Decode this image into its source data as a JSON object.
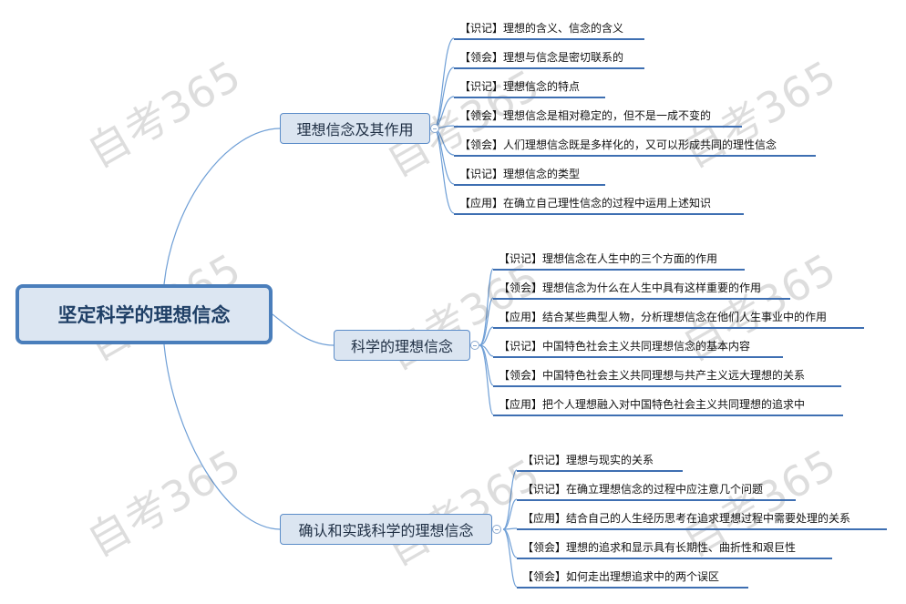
{
  "watermark": "自考365",
  "root": {
    "label": "坚定科学的理想信念"
  },
  "branches": [
    {
      "label": "理想信念及其作用",
      "items": [
        "【识记】理想的含义、信念的含义",
        "【领会】理想与信念是密切联系的",
        "【识记】理想信念的特点",
        "【领会】理想信念是相对稳定的，但不是一成不变的",
        "【领会】人们理想信念既是多样化的，又可以形成共同的理性信念",
        "【识记】理想信念的类型",
        "【应用】在确立自己理性信念的过程中运用上述知识"
      ]
    },
    {
      "label": "科学的理想信念",
      "items": [
        "【识记】理想信念在人生中的三个方面的作用",
        "【领会】理想信念为什么在人生中具有这样重要的作用",
        "【应用】结合某些典型人物，分析理想信念在他们人生事业中的作用",
        "【识记】中国特色社会主义共同理想信念的基本内容",
        "【领会】中国特色社会主义共同理想与共产主义远大理想的关系",
        "【应用】把个人理想融入对中国特色社会主义共同理想的追求中"
      ]
    },
    {
      "label": "确认和实践科学的理想信念",
      "items": [
        "【识记】理想与现实的关系",
        "【识记】在确立理想信念的过程中应注意几个问题",
        "【应用】结合自己的人生经历思考在追求理想过程中需要处理的关系",
        "【领会】理想的追求和显示具有长期性、曲折性和艰巨性",
        "【领会】如何走出理想追求中的两个误区"
      ]
    }
  ]
}
